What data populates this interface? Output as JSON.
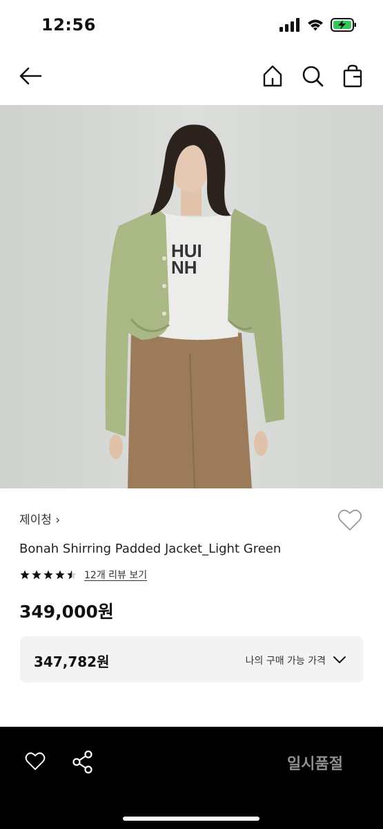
{
  "status_bar": {
    "time": "12:56"
  },
  "nav": {
    "back_icon": "arrow-left-icon",
    "home_icon": "home-icon",
    "search_icon": "search-icon",
    "bag_icon": "shopping-bag-icon"
  },
  "product": {
    "brand": "제이청 ›",
    "title": "Bonah Shirring Padded Jacket_Light Green",
    "rating": 4.5,
    "review_link": "12개 리뷰 보기",
    "price": "349,000원",
    "my_price": {
      "value": "347,782원",
      "label": "나의 구매 가능 가격"
    }
  },
  "bottom_bar": {
    "soldout_label": "일시품절"
  },
  "colors": {
    "hero_bg": "#d5d7d5",
    "bottom_bar": "#000000",
    "soldout_text": "#8f8f8f",
    "price_box": "#f3f3f4"
  }
}
